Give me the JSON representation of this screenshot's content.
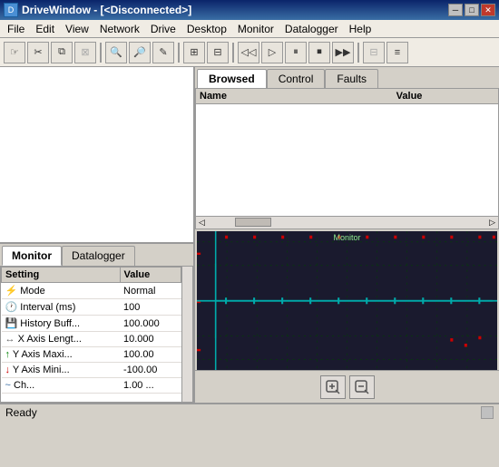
{
  "window": {
    "title": "DriveWindow - [<Disconnected>]",
    "icon": "D"
  },
  "title_buttons": [
    {
      "label": "─",
      "name": "minimize-button"
    },
    {
      "label": "□",
      "name": "maximize-button"
    },
    {
      "label": "✕",
      "name": "close-button",
      "type": "close"
    }
  ],
  "menu": {
    "items": [
      {
        "label": "File",
        "name": "file-menu"
      },
      {
        "label": "Edit",
        "name": "edit-menu"
      },
      {
        "label": "View",
        "name": "view-menu"
      },
      {
        "label": "Network",
        "name": "network-menu"
      },
      {
        "label": "Drive",
        "name": "drive-menu"
      },
      {
        "label": "Desktop",
        "name": "desktop-menu"
      },
      {
        "label": "Monitor",
        "name": "monitor-menu"
      },
      {
        "label": "Datalogger",
        "name": "datalogger-menu"
      },
      {
        "label": "Help",
        "name": "help-menu"
      }
    ]
  },
  "toolbar": {
    "groups": [
      [
        "☞",
        "✂",
        "⧉",
        "⊠"
      ],
      [
        "🔍",
        "🔎",
        "✎"
      ],
      [
        "⊞",
        "⊟"
      ],
      [
        "◁◁",
        "▷",
        "⏸",
        "⏹",
        "▷▷"
      ],
      [
        "⊟",
        "≡"
      ]
    ]
  },
  "browse_tabs": [
    {
      "label": "Browsed",
      "active": true,
      "name": "tab-browsed"
    },
    {
      "label": "Control",
      "active": false,
      "name": "tab-control"
    },
    {
      "label": "Faults",
      "active": false,
      "name": "tab-faults"
    }
  ],
  "browse_columns": [
    {
      "label": "Name",
      "name": "col-name"
    },
    {
      "label": "Value",
      "name": "col-value"
    }
  ],
  "monitor_tabs": [
    {
      "label": "Monitor",
      "active": true,
      "name": "tab-monitor"
    },
    {
      "label": "Datalogger",
      "active": false,
      "name": "tab-datalogger"
    }
  ],
  "settings": {
    "columns": [
      {
        "label": "Setting",
        "name": "col-setting"
      },
      {
        "label": "Value",
        "name": "col-value"
      }
    ],
    "rows": [
      {
        "icon": "⚡",
        "setting": "Mode",
        "value": "Normal",
        "icon_color": "#cc6600"
      },
      {
        "icon": "🕐",
        "setting": "Interval (ms)",
        "value": "100",
        "icon_color": "#3a6ea5"
      },
      {
        "icon": "💾",
        "setting": "History Buff...",
        "value": "100.000",
        "icon_color": "#4a90d9"
      },
      {
        "icon": "↔",
        "setting": "X Axis Lengt...",
        "value": "10.000",
        "icon_color": "#666"
      },
      {
        "icon": "↑",
        "setting": "Y Axis Maxi...",
        "value": "100.00",
        "icon_color": "#008000"
      },
      {
        "icon": "↓",
        "setting": "Y Axis Mini...",
        "value": "-100.00",
        "icon_color": "#cc0000"
      },
      {
        "icon": "~",
        "setting": "Ch...",
        "value": "1.00 ...",
        "icon_color": "#3a6ea5"
      }
    ]
  },
  "chart": {
    "label": "Monitor",
    "label_color": "#90ee90",
    "bg_color": "#1a1a2e",
    "grid_color": "#2a4a2a",
    "axis_color": "#00aaaa",
    "line_color": "#00ffaa"
  },
  "bottom_buttons": [
    {
      "icon": "⊞",
      "name": "zoom-in-button"
    },
    {
      "icon": "⊟",
      "name": "zoom-out-button"
    }
  ],
  "status": {
    "text": "Ready",
    "name": "status-text"
  }
}
